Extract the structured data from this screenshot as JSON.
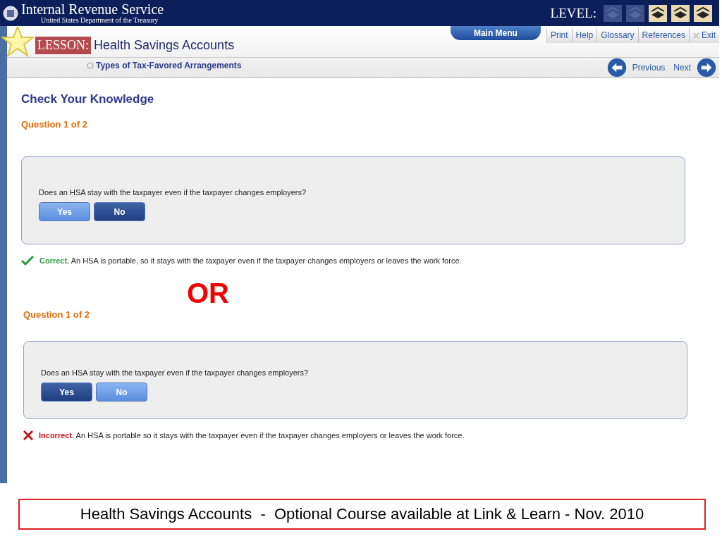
{
  "header": {
    "agency": "Internal Revenue Service",
    "department": "United States Department of the Treasury",
    "level_label": "LEVEL:",
    "levels": [
      {
        "active": false
      },
      {
        "active": false
      },
      {
        "active": true
      },
      {
        "active": true
      },
      {
        "active": true
      }
    ]
  },
  "lesson": {
    "label": "LESSON:",
    "title": "Health Savings Accounts",
    "topic": "Types of Tax-Favored Arrangements"
  },
  "menu": {
    "main": "Main Menu",
    "links": [
      {
        "label": "Print",
        "kind": "plain"
      },
      {
        "label": "Help",
        "kind": "plain"
      },
      {
        "label": "Glossary",
        "kind": "plain"
      },
      {
        "label": "References",
        "kind": "plain"
      },
      {
        "label": "Exit",
        "kind": "exit"
      }
    ]
  },
  "nav": {
    "previous": "Previous",
    "next": "Next"
  },
  "page_title": "Check Your Knowledge",
  "blocks": [
    {
      "counter": "Question 1 of 2",
      "question": "Does an HSA stay with the taxpayer even if the taxpayer changes employers?",
      "answers": [
        {
          "label": "Yes",
          "selected": false
        },
        {
          "label": "No",
          "selected": true
        }
      ],
      "feedback": {
        "kind": "correct",
        "verdict": "Correct.",
        "text": "An HSA is portable, so it stays with the taxpayer even if the taxpayer changes employers or leaves the work force."
      }
    },
    {
      "counter": "Question 1 of 2",
      "question": "Does an HSA stay with the taxpayer even if the taxpayer changes employers?",
      "answers": [
        {
          "label": "Yes",
          "selected": true
        },
        {
          "label": "No",
          "selected": false
        }
      ],
      "feedback": {
        "kind": "incorrect",
        "verdict": "Incorrect.",
        "text": "An HSA is portable so it stays with the taxpayer even if the taxpayer changes employers or leaves the work force."
      }
    }
  ],
  "separator": "OR",
  "caption": "Health Savings Accounts  -  Optional Course available at Link & Learn - Nov. 2010"
}
